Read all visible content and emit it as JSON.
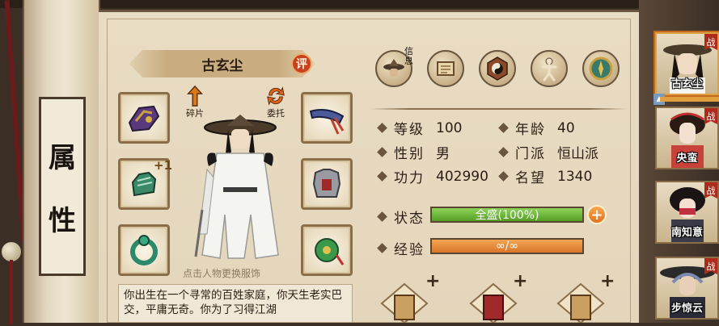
{
  "page": {
    "side_title": [
      "属",
      "性"
    ]
  },
  "character": {
    "name": "古玄尘",
    "review_badge": "评",
    "hint": "点击人物更换服饰",
    "bio": "你出生在一个寻常的百姓家庭，你天生老实巴交，平庸无奇。你为了习得江湖"
  },
  "actions": {
    "fragments_label": "碎片",
    "delegate_label": "委托"
  },
  "equipment": {
    "gauntlet_plus": "+1"
  },
  "tabs": {
    "info_label": "信息",
    "icons": [
      "hat-icon",
      "scroll-icon",
      "taiji-icon",
      "meridian-figure-icon",
      "compass-icon"
    ]
  },
  "stats": {
    "level": {
      "label": "等级",
      "value": "100"
    },
    "age": {
      "label": "年龄",
      "value": "40"
    },
    "gender": {
      "label": "性别",
      "value": "男"
    },
    "sect": {
      "label": "门派",
      "value": "恒山派"
    },
    "power": {
      "label": "功力",
      "value": "402990"
    },
    "fame": {
      "label": "名望",
      "value": "1340"
    },
    "status": {
      "label": "状态",
      "value": "全盛(100%)",
      "fill_fraction": 1.0
    },
    "exp": {
      "label": "经验",
      "value": "∞/∞",
      "fill_fraction": 1.0
    }
  },
  "book_slots": {
    "plus": "+"
  },
  "roster": [
    {
      "name": "古玄尘",
      "badge": "战",
      "active": true
    },
    {
      "name": "央蛮",
      "badge": "战",
      "active": false
    },
    {
      "name": "南知意",
      "badge": "战",
      "active": false
    },
    {
      "name": "步惊云",
      "badge": "战",
      "active": false
    }
  ],
  "colors": {
    "hp_bar": "#6cb83a",
    "exp_bar": "#e48a3a",
    "badge_red": "#c9421e"
  }
}
